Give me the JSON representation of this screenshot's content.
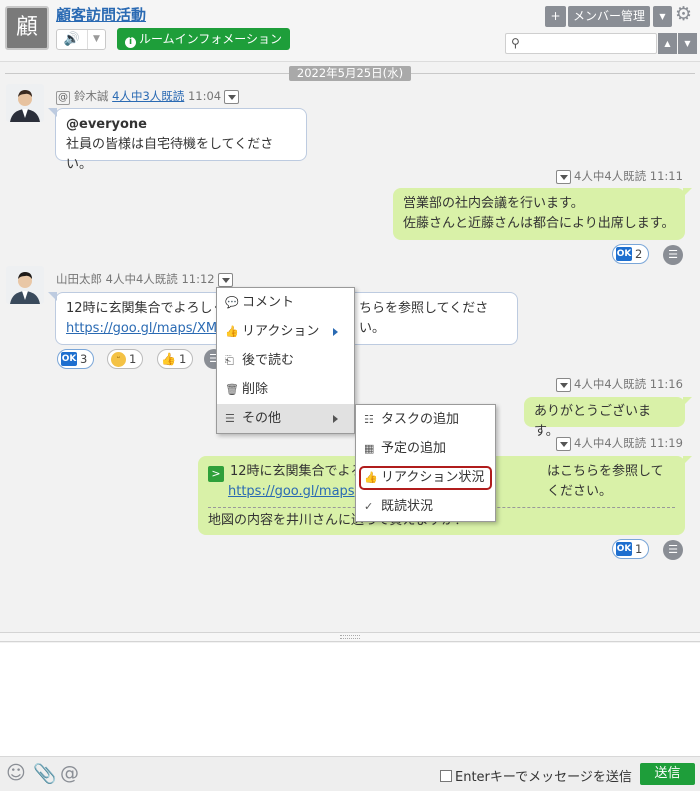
{
  "header": {
    "room_icon_char": "顧",
    "room_title": "顧客訪問活動",
    "room_info_label": "ルームインフォメーション",
    "add_icon": "plus-icon",
    "members_label": "メンバー管理",
    "search_placeholder": ""
  },
  "date_separator": "2022年5月25日(水)",
  "messages": [
    {
      "sender": "鈴木誠",
      "read_status": "4人中3人既読",
      "time": "11:04",
      "mention": "@everyone",
      "text": "社員の皆様は自宅待機をしてください。"
    },
    {
      "read_status": "4人中4人既読",
      "time": "11:11",
      "line1": "営業部の社内会議を行います。",
      "line2": "佐藤さんと近藤さんは都合により出席します。",
      "reactions": [
        {
          "icon": "ok-icon",
          "count": "2"
        }
      ]
    },
    {
      "sender": "山田太郎",
      "read_status": "4人中4人既読",
      "time": "11:12",
      "text_start": "12時に玄関集合でよろしく",
      "text_end": "ちらを参照してください。",
      "link_start": "https://goo.gl/maps/XM",
      "reactions": [
        {
          "icon": "ok-icon",
          "count": "3"
        },
        {
          "icon": "smile-icon",
          "count": "1"
        },
        {
          "icon": "thumbs-up-icon",
          "count": "1"
        }
      ]
    },
    {
      "read_status": "4人中4人既読",
      "time": "11:16",
      "text": "ありがとうございます。"
    },
    {
      "read_status": "4人中4人既読",
      "time": "11:19",
      "quote_start": "12時に玄関集合でよろ",
      "quote_end": "はこちらを参照してください。",
      "link_start": "https://goo.gl/maps",
      "reply_text": "地図の内容を井川さんに送って貰えますか？",
      "reactions": [
        {
          "icon": "ok-icon",
          "count": "1"
        }
      ]
    }
  ],
  "context_menu": {
    "items": [
      "コメント",
      "リアクション",
      "後で読む",
      "削除",
      "その他"
    ]
  },
  "submenu": {
    "items": [
      "タスクの追加",
      "予定の追加",
      "リアクション状況",
      "既読状況"
    ]
  },
  "composer": {
    "enter_label": "Enterキーでメッセージを送信",
    "send_label": "送信"
  },
  "colors": {
    "accent_green": "#1e9e3a",
    "link_blue": "#2a6ab3",
    "bubble_green": "#d9f1a8",
    "highlight_red": "#b01c1c"
  }
}
